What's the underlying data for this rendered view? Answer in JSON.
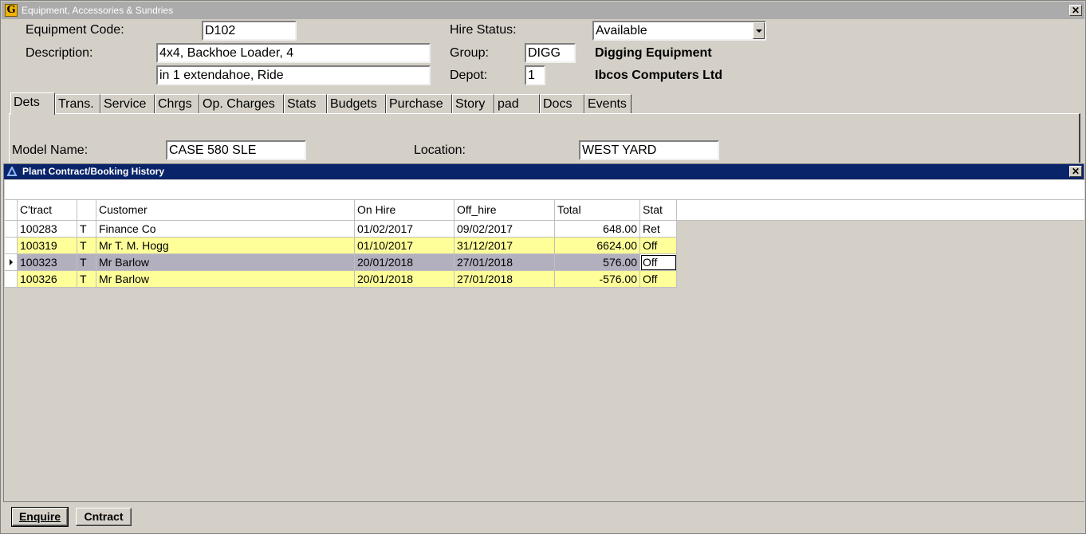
{
  "window": {
    "title": "Equipment, Accessories & Sundries",
    "icon": "G"
  },
  "header": {
    "equipment_code_label": "Equipment Code:",
    "equipment_code": "D102",
    "description_label": "Description:",
    "description_line1": "4x4, Backhoe Loader, 4",
    "description_line2": "in 1 extendahoe, Ride",
    "hire_status_label": "Hire Status:",
    "hire_status": "Available",
    "group_label": "Group:",
    "group_code": "DIGG",
    "group_name": "Digging Equipment",
    "depot_label": "Depot:",
    "depot_code": "1",
    "depot_name": "Ibcos Computers Ltd"
  },
  "tabs": [
    "Dets",
    "Trans.",
    "Service",
    "Chrgs",
    "Op. Charges",
    "Stats",
    "Budgets",
    "Purchase",
    "Story",
    "pad",
    "Docs",
    "Events"
  ],
  "details": {
    "model_name_label": "Model Name:",
    "model_name": "CASE 580 SLE",
    "location_label": "Location:",
    "location": "WEST YARD"
  },
  "history": {
    "title": "Plant Contract/Booking History",
    "columns": [
      "C'tract",
      "",
      "Customer",
      "On Hire",
      "Off_hire",
      "Total",
      "Stat"
    ],
    "rows": [
      {
        "contract": "100283",
        "type": "T",
        "customer": "Finance Co",
        "on_hire": "01/02/2017",
        "off_hire": "09/02/2017",
        "total": "648.00",
        "stat": "Ret"
      },
      {
        "contract": "100319",
        "type": "T",
        "customer": "Mr T. M. Hogg",
        "on_hire": "01/10/2017",
        "off_hire": "31/12/2017",
        "total": "6624.00",
        "stat": "Off"
      },
      {
        "contract": "100323",
        "type": "T",
        "customer": "Mr Barlow",
        "on_hire": "20/01/2018",
        "off_hire": "27/01/2018",
        "total": "576.00",
        "stat": "Off"
      },
      {
        "contract": "100326",
        "type": "T",
        "customer": "Mr Barlow",
        "on_hire": "20/01/2018",
        "off_hire": "27/01/2018",
        "total": "-576.00",
        "stat": "Off"
      }
    ]
  },
  "buttons": {
    "enquire": "Enquire",
    "contract": "Cntract"
  },
  "colors": {
    "row_yellow": "#ffff99",
    "row_selected": "#b2b0bf",
    "subwindow_title": "#0a246a"
  }
}
